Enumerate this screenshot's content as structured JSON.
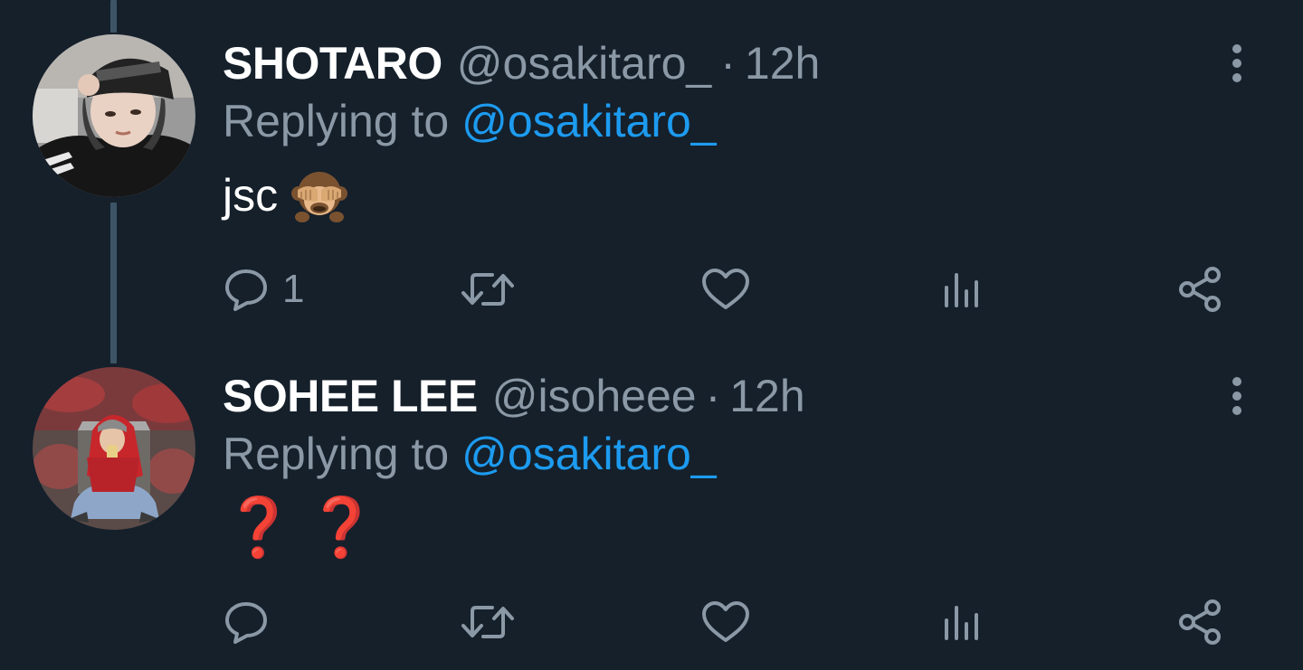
{
  "tweets": [
    {
      "display_name": "SHOTARO",
      "handle": "@osakitaro_",
      "separator": "·",
      "time": "12h",
      "reply_prefix": "Replying to",
      "reply_to": "@osakitaro_",
      "text": "jsc",
      "emoji": "see-no-evil-monkey",
      "reply_count": "1",
      "avatar": "user-photo-hat-bandana"
    },
    {
      "display_name": "SOHEE LEE",
      "handle": "@isoheee",
      "separator": "·",
      "time": "12h",
      "reply_prefix": "Replying to",
      "reply_to": "@osakitaro_",
      "text": "❓❓",
      "emoji": "red-question-mark",
      "reply_count": "",
      "avatar": "user-photo-red-hoodie"
    }
  ],
  "icons": {
    "reply": "reply-icon",
    "retweet": "retweet-icon",
    "like": "heart-icon",
    "stats": "analytics-icon",
    "share": "share-icon",
    "more": "more-vertical-icon"
  },
  "colors": {
    "background": "#15202b",
    "secondary_text": "#8b98a5",
    "link": "#1d9bf0",
    "thread_line": "#3d5466",
    "question_mark": "#d81b30"
  }
}
